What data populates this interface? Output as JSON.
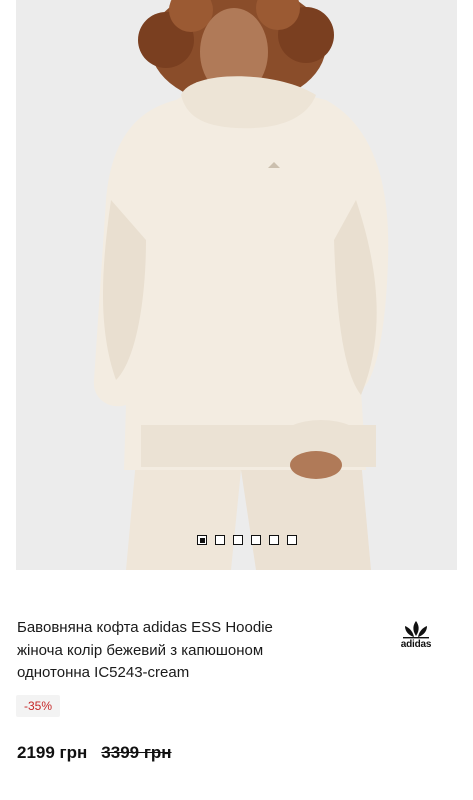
{
  "product": {
    "title": "Бавовняна кофта adidas ESS Hoodie жіноча колір бежевий з капюшоном однотонна IC5243-cream",
    "brand_logo_text": "adidas",
    "discount": "-35%",
    "price_current": "2199 грн",
    "price_old": "3399 грн"
  },
  "gallery": {
    "count": 6,
    "active_index": 0
  },
  "colors": {
    "discount_text": "#c62828",
    "image_bg": "#ececec",
    "hoodie": "#f1e9dd"
  },
  "icons": [
    "adidas-trefoil-icon"
  ]
}
